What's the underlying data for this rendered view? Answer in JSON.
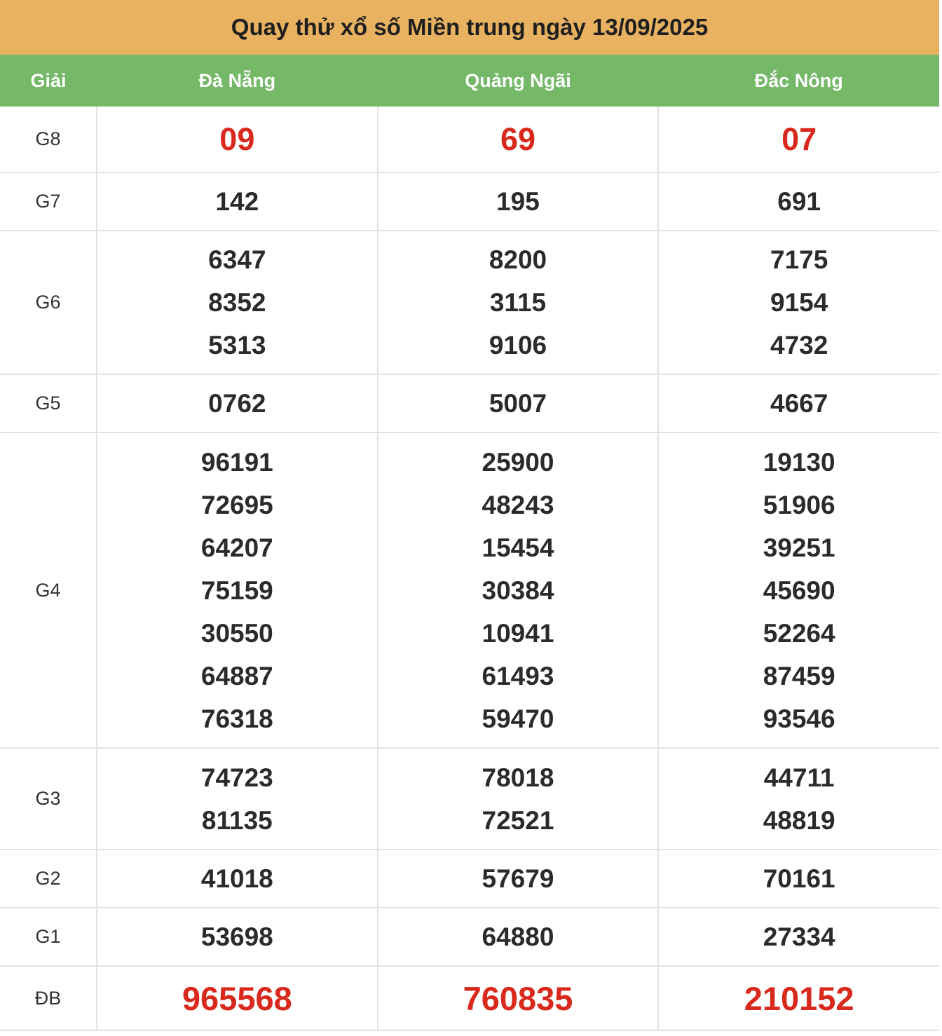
{
  "title": "Quay thử xổ số Miền trung ngày 13/09/2025",
  "header": {
    "label_col": "Giải",
    "provinces": [
      "Đà Nẵng",
      "Quảng Ngãi",
      "Đắc Nông"
    ]
  },
  "rows": [
    {
      "label": "G8",
      "values": [
        [
          "09"
        ],
        [
          "69"
        ],
        [
          "07"
        ]
      ]
    },
    {
      "label": "G7",
      "values": [
        [
          "142"
        ],
        [
          "195"
        ],
        [
          "691"
        ]
      ]
    },
    {
      "label": "G6",
      "values": [
        [
          "6347",
          "8352",
          "5313"
        ],
        [
          "8200",
          "3115",
          "9106"
        ],
        [
          "7175",
          "9154",
          "4732"
        ]
      ]
    },
    {
      "label": "G5",
      "values": [
        [
          "0762"
        ],
        [
          "5007"
        ],
        [
          "4667"
        ]
      ]
    },
    {
      "label": "G4",
      "values": [
        [
          "96191",
          "72695",
          "64207",
          "75159",
          "30550",
          "64887",
          "76318"
        ],
        [
          "25900",
          "48243",
          "15454",
          "30384",
          "10941",
          "61493",
          "59470"
        ],
        [
          "19130",
          "51906",
          "39251",
          "45690",
          "52264",
          "87459",
          "93546"
        ]
      ]
    },
    {
      "label": "G3",
      "values": [
        [
          "74723",
          "81135"
        ],
        [
          "78018",
          "72521"
        ],
        [
          "44711",
          "48819"
        ]
      ]
    },
    {
      "label": "G2",
      "values": [
        [
          "41018"
        ],
        [
          "57679"
        ],
        [
          "70161"
        ]
      ]
    },
    {
      "label": "G1",
      "values": [
        [
          "53698"
        ],
        [
          "64880"
        ],
        [
          "27334"
        ]
      ]
    },
    {
      "label": "ĐB",
      "values": [
        [
          "965568"
        ],
        [
          "760835"
        ],
        [
          "210152"
        ]
      ]
    }
  ],
  "colors": {
    "title_bg": "#e8b260",
    "header_bg": "#74b868",
    "highlight": "#d8291c"
  }
}
